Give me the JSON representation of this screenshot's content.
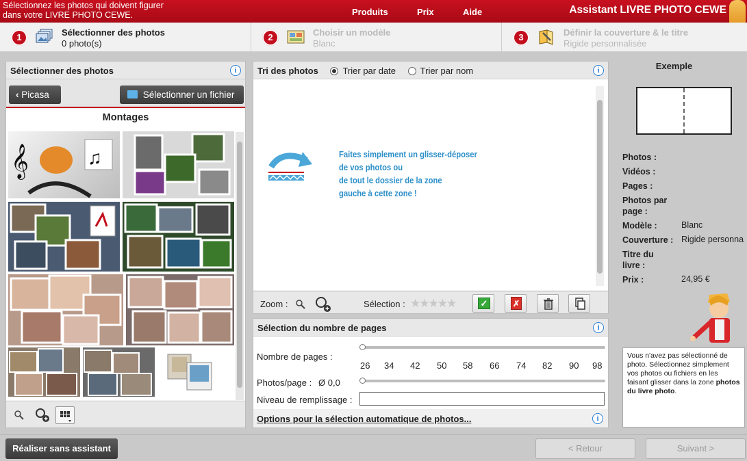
{
  "topbar": {
    "message_line1": "Sélectionnez les photos qui doivent figurer",
    "message_line2": "dans votre LIVRE PHOTO CEWE.",
    "nav": [
      "Produits",
      "Prix",
      "Aide"
    ],
    "brand": "Assistant LIVRE PHOTO CEWE"
  },
  "steps": [
    {
      "num": "1",
      "title": "Sélectionner des photos",
      "sub": "0 photo(s)"
    },
    {
      "num": "2",
      "title": "Choisir un modèle",
      "sub": "Blanc"
    },
    {
      "num": "3",
      "title": "Définir la couverture & le titre",
      "sub": "Rigide personnalisée"
    }
  ],
  "left_panel": {
    "title": "Sélectionner des photos",
    "back_button": "Picasa",
    "file_button": "Sélectionner un fichier",
    "folder_title": "Montages"
  },
  "sort_panel": {
    "title": "Tri des photos",
    "opt_date": "Trier par date",
    "opt_name": "Trier par nom",
    "drop_text": [
      "Faites simplement un glisser-déposer",
      "de vos photos ou",
      "de tout le dossier de la zone",
      "gauche à cette zone !"
    ],
    "zoom_label": "Zoom :",
    "selection_label": "Sélection :"
  },
  "pages_panel": {
    "title": "Sélection du nombre de pages",
    "pages_label": "Nombre de pages :",
    "ticks": [
      "26",
      "34",
      "42",
      "50",
      "58",
      "66",
      "74",
      "82",
      "90",
      "98"
    ],
    "photos_per_page_label": "Photos/page :",
    "photos_per_page_value": "Ø 0,0",
    "fill_label": "Niveau de remplissage :",
    "auto_link": "Options pour la sélection automatique de photos..."
  },
  "summary": {
    "title": "Exemple",
    "photos_label": "Photos :",
    "videos_label": "Vidéos :",
    "pages_label": "Pages :",
    "ppp_label_1": "Photos par",
    "ppp_label_2": "page :",
    "model_label": "Modèle :",
    "model_value": "Blanc",
    "cover_label": "Couverture :",
    "cover_value": "Rigide personna",
    "title_label_1": "Titre du",
    "title_label_2": "livre :",
    "price_label": "Prix :",
    "price_value": "24,95 €",
    "help_text_1": "Vous n'avez pas sélectionné de photo. Sélectionnez simplement vos photos ou fichiers en les faisant glisser dans la zone ",
    "help_text_bold": "photos du livre photo",
    "help_text_2": "."
  },
  "footer": {
    "no_assistant": "Réaliser sans assistant",
    "back": "< Retour",
    "next": "Suivant >"
  },
  "colors": {
    "brand_red": "#c30f1d",
    "drop_text_blue": "#2c8fc9",
    "info_blue": "#2a7fd6"
  }
}
